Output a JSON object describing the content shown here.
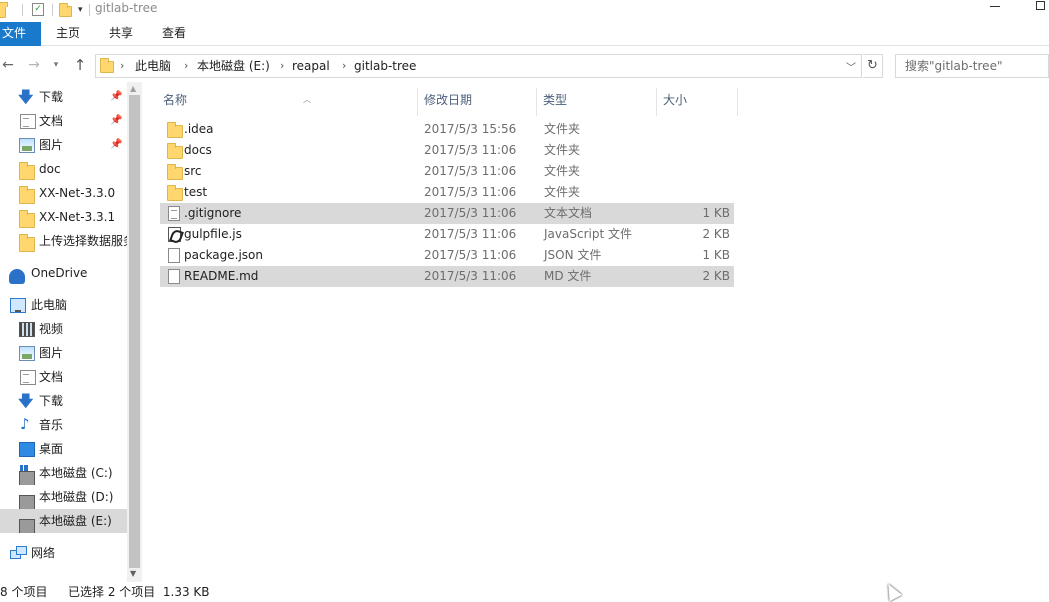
{
  "window": {
    "title": "gitlab-tree"
  },
  "ribbon": {
    "tabs": [
      {
        "label": "文件"
      },
      {
        "label": "主页"
      },
      {
        "label": "共享"
      },
      {
        "label": "查看"
      }
    ]
  },
  "address": {
    "crumbs": [
      "此电脑",
      "本地磁盘 (E:)",
      "reapal",
      "gitlab-tree"
    ],
    "search_placeholder": "搜索\"gitlab-tree\""
  },
  "nav": {
    "items": [
      {
        "label": "下载",
        "icon": "arrow-down-icon",
        "pinned": true
      },
      {
        "label": "文档",
        "icon": "document-icon",
        "pinned": true
      },
      {
        "label": "图片",
        "icon": "picture-icon",
        "pinned": true
      },
      {
        "label": "doc",
        "icon": "folder-icon"
      },
      {
        "label": "XX-Net-3.3.0",
        "icon": "folder-icon"
      },
      {
        "label": "XX-Net-3.3.1",
        "icon": "folder-icon"
      },
      {
        "label": "上传选择数据服务",
        "icon": "folder-icon"
      },
      {
        "label": "OneDrive",
        "icon": "cloud-icon"
      },
      {
        "label": "此电脑",
        "icon": "computer-icon"
      },
      {
        "label": "视频",
        "icon": "video-icon"
      },
      {
        "label": "图片",
        "icon": "picture-icon"
      },
      {
        "label": "文档",
        "icon": "document-icon"
      },
      {
        "label": "下载",
        "icon": "arrow-down-icon"
      },
      {
        "label": "音乐",
        "icon": "music-icon"
      },
      {
        "label": "桌面",
        "icon": "desktop-icon"
      },
      {
        "label": "本地磁盘 (C:)",
        "icon": "drive-icon"
      },
      {
        "label": "本地磁盘 (D:)",
        "icon": "drive-icon"
      },
      {
        "label": "本地磁盘 (E:)",
        "icon": "drive-icon",
        "selected": true
      },
      {
        "label": "网络",
        "icon": "network-icon"
      }
    ],
    "pin_glyph": "📌"
  },
  "list": {
    "columns": {
      "name": "名称",
      "date": "修改日期",
      "type": "类型",
      "size": "大小"
    },
    "rows": [
      {
        "name": ".idea",
        "date": "2017/5/3 15:56",
        "type": "文件夹",
        "size": "",
        "icon": "folder-icon"
      },
      {
        "name": "docs",
        "date": "2017/5/3 11:06",
        "type": "文件夹",
        "size": "",
        "icon": "folder-icon"
      },
      {
        "name": "src",
        "date": "2017/5/3 11:06",
        "type": "文件夹",
        "size": "",
        "icon": "folder-icon"
      },
      {
        "name": "test",
        "date": "2017/5/3 11:06",
        "type": "文件夹",
        "size": "",
        "icon": "folder-icon"
      },
      {
        "name": ".gitignore",
        "date": "2017/5/3 11:06",
        "type": "文本文档",
        "size": "1 KB",
        "icon": "text-file-icon",
        "selected": true
      },
      {
        "name": "gulpfile.js",
        "date": "2017/5/3 11:06",
        "type": "JavaScript 文件",
        "size": "2 KB",
        "icon": "js-file-icon"
      },
      {
        "name": "package.json",
        "date": "2017/5/3 11:06",
        "type": "JSON 文件",
        "size": "1 KB",
        "icon": "file-icon"
      },
      {
        "name": "README.md",
        "date": "2017/5/3 11:06",
        "type": "MD 文件",
        "size": "2 KB",
        "icon": "file-icon",
        "selected": true
      }
    ]
  },
  "status": {
    "count": "8 个项目",
    "selection": "已选择 2 个项目  1.33 KB"
  },
  "colors": {
    "accent": "#1979ca",
    "selection": "#d9d9d9",
    "folder": "#ffd76e"
  }
}
